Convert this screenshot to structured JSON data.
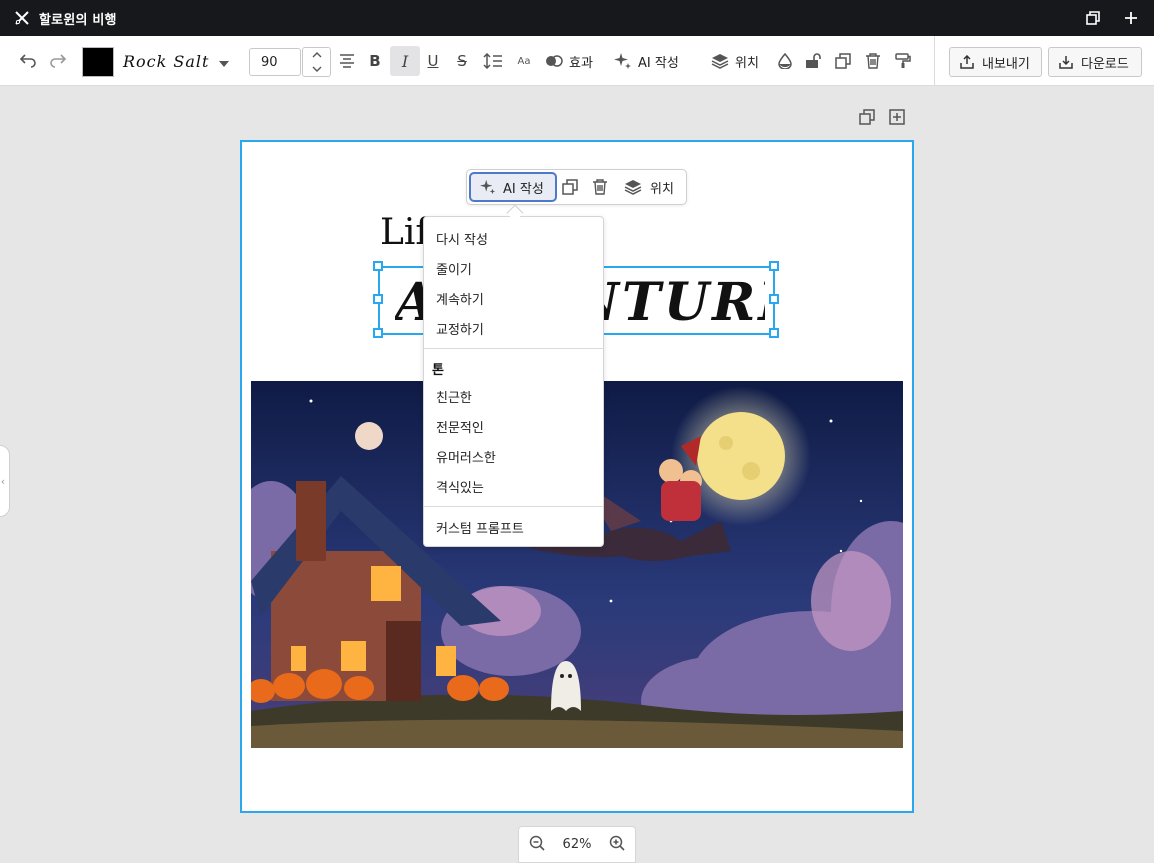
{
  "app": {
    "title": "할로윈의 비행",
    "icons": {
      "app": "tools-icon",
      "restore": "restore-window-icon",
      "add": "plus-icon"
    }
  },
  "toolbar": {
    "color": "#000000",
    "font_name": "Rock Salt",
    "font_size": "90",
    "effects_label": "효과",
    "ai_write_label": "AI 작성",
    "position_label": "위치",
    "export_label": "내보내기",
    "download_label": "다운로드"
  },
  "canvas": {
    "heading_partial": "Lif",
    "heading_text": "ADVENTURE",
    "zoom": "62%"
  },
  "float_toolbar": {
    "ai_write_label": "AI 작성",
    "position_label": "위치"
  },
  "ai_menu": {
    "items": [
      "다시 작성",
      "줄이기",
      "계속하기",
      "교정하기"
    ],
    "tone_header": "톤",
    "tones": [
      "친근한",
      "전문적인",
      "유머러스한",
      "격식있는"
    ],
    "custom_prompt": "커스텀 프롬프트"
  },
  "colors": {
    "selection": "#29a8f0",
    "titlebar": "#17181c",
    "accent_ai": "#4e79c9"
  }
}
